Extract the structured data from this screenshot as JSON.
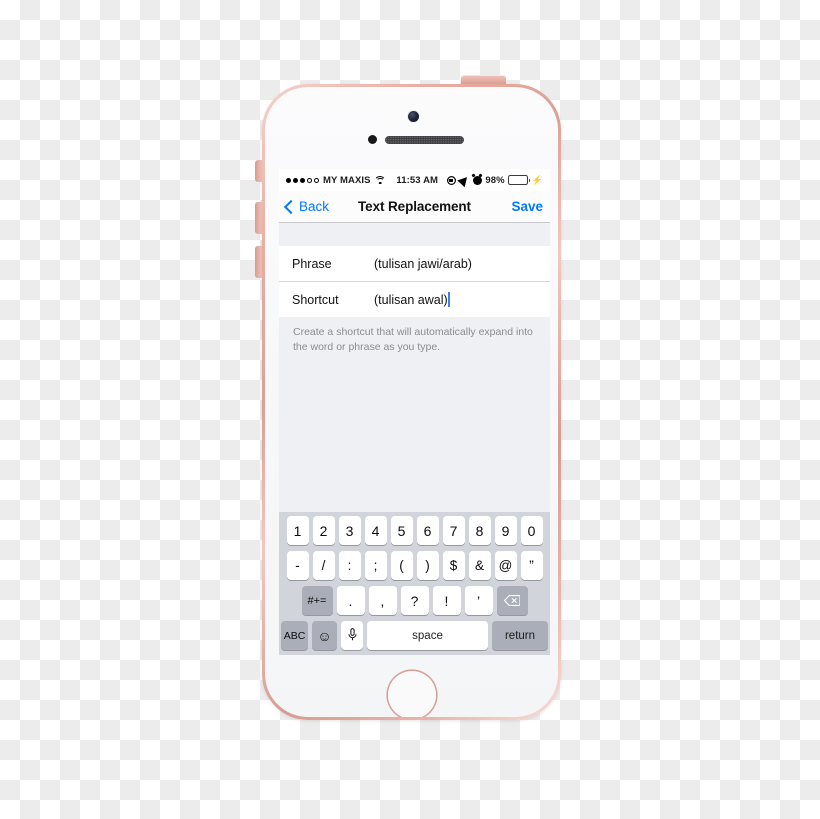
{
  "device": {
    "name": "iPhone SE Rose Gold",
    "frame_color": "#dda094",
    "body_color": "#f7f7f9",
    "hardware": {
      "front_camera": "front-camera",
      "earpiece": "earpiece-speaker",
      "proximity_sensor": "proximity-sensor",
      "home_button": "home-button",
      "power_button": "power-button",
      "mute_switch": "mute-switch",
      "volume_up": "volume-up-button",
      "volume_down": "volume-down-button"
    }
  },
  "status_bar": {
    "carrier": "MY MAXIS",
    "signal_filled": 3,
    "signal_empty": 2,
    "wifi": "wifi-icon",
    "time": "11:53 AM",
    "rotation_lock": "rotation-lock-icon",
    "location": "location-arrow-icon",
    "alarm": "alarm-clock-icon",
    "battery_percent": "98%",
    "battery_level": 98,
    "battery_color": "#4cd552",
    "charging": "⚡"
  },
  "nav_bar": {
    "back_label": "Back",
    "title": "Text Replacement",
    "save_label": "Save",
    "accent_color": "#007aff"
  },
  "form": {
    "rows": [
      {
        "label": "Phrase",
        "value": "(tulisan jawi/arab)",
        "focused": false
      },
      {
        "label": "Shortcut",
        "value": "(tulisan awal)",
        "focused": true
      }
    ],
    "helper_text": "Create a shortcut that will automatically expand into the word or phrase as you type."
  },
  "keyboard": {
    "background": "#d1d4da",
    "rows": {
      "numbers": [
        "1",
        "2",
        "3",
        "4",
        "5",
        "6",
        "7",
        "8",
        "9",
        "0"
      ],
      "symbols": [
        "-",
        "/",
        ":",
        ";",
        "(",
        ")",
        "$",
        "&",
        "@",
        "”"
      ],
      "punct_modifier": "#+=",
      "punctuation": [
        ".",
        ",",
        "?",
        "!",
        "’"
      ],
      "delete": "delete-key",
      "bottom": {
        "abc": "ABC",
        "emoji": "☺",
        "dictation": "microphone",
        "space": "space",
        "return": "return"
      }
    }
  }
}
